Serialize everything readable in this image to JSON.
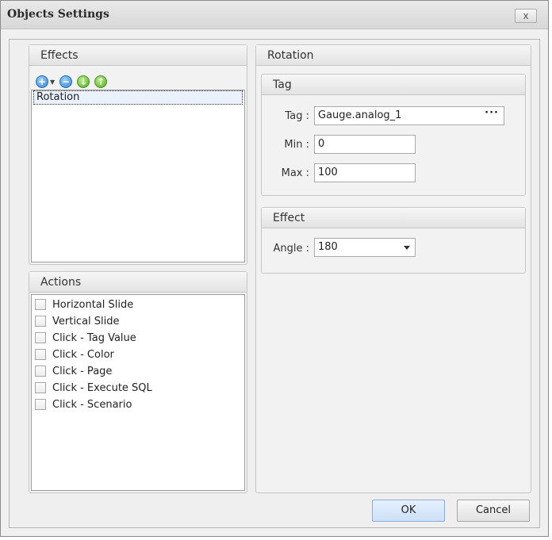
{
  "window": {
    "title": "Objects Settings",
    "close_glyph": "x"
  },
  "effects": {
    "header": "Effects",
    "toolbar": [
      "add-icon",
      "remove-icon",
      "move-down-icon",
      "move-up-icon"
    ],
    "items": [
      "Rotation"
    ]
  },
  "actions": {
    "header": "Actions",
    "items": [
      "Horizontal Slide",
      "Vertical Slide",
      "Click - Tag Value",
      "Click - Color",
      "Click - Page",
      "Click - Execute SQL",
      "Click - Scenario"
    ]
  },
  "rotation": {
    "header": "Rotation",
    "tag_group": {
      "header": "Tag",
      "tag_label": "Tag :",
      "tag_value": "Gauge.analog_1",
      "tag_browse": "···",
      "min_label": "Min :",
      "min_value": "0",
      "max_label": "Max :",
      "max_value": "100"
    },
    "effect_group": {
      "header": "Effect",
      "angle_label": "Angle :",
      "angle_value": "180"
    }
  },
  "buttons": {
    "ok": "OK",
    "cancel": "Cancel"
  },
  "colors": {
    "accent": "#2f82d6",
    "green": "#53a91f",
    "ok_button": "#cde0f7"
  }
}
